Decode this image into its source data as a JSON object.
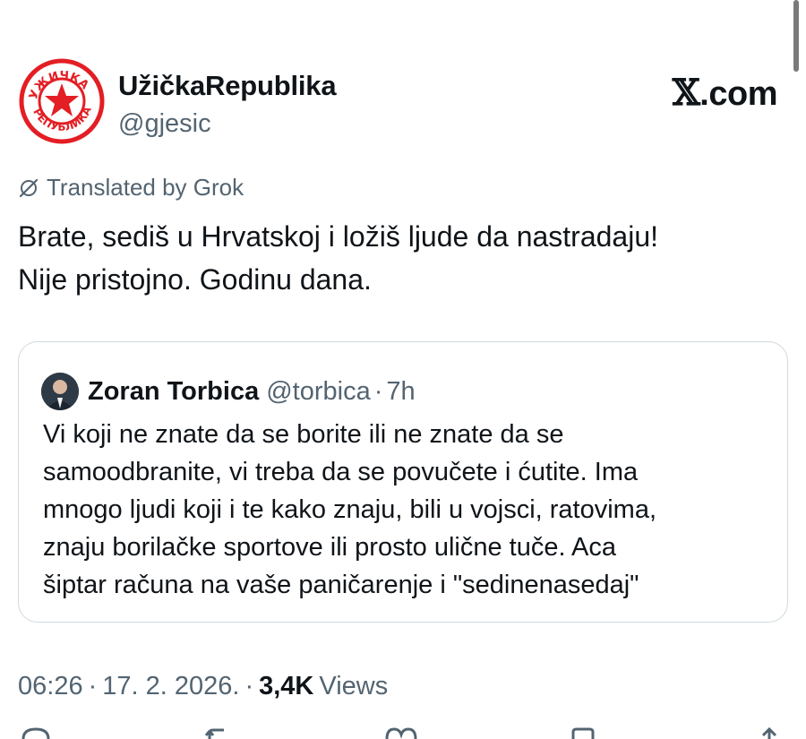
{
  "author": {
    "display_name": "UžičkaRepublika",
    "handle": "@gjesic",
    "avatar": {
      "icon": "red-star-emblem-icon",
      "text_top": "УЖИЧКА",
      "text_bottom": "РЕПУБЛИКА",
      "color": "#e31e24"
    }
  },
  "brand": {
    "x": "𝕏",
    "domain": ".com"
  },
  "translation": {
    "icon": "grok-icon",
    "label": "Translated by Grok"
  },
  "tweet": {
    "lines": [
      "Brate, sediš u Hrvatskoj i ložiš ljude da nastradaju!",
      "Nije pristojno. Godinu dana."
    ]
  },
  "quote": {
    "name": "Zoran Torbica",
    "handle": "@torbica",
    "separator": "·",
    "time": "7h",
    "lines": [
      "Vi koji ne znate da se borite ili ne znate da se",
      "samoodbranite, vi treba da se povučete i ćutite. Ima",
      "mnogo ljudi koji i te kako znaju, bili u vojsci, ratovima,",
      "znaju borilačke sportove ili prosto ulične tuče. Aca",
      "šiptar  računa na vaše paničarenje i \"sedinenasedaj\""
    ]
  },
  "meta": {
    "time": "06:26",
    "date": "17. 2. 2026.",
    "separator": "·",
    "views_count": "3,4K",
    "views_label": "Views"
  },
  "actions": [
    "reply-icon",
    "repost-icon",
    "like-icon",
    "bookmark-icon",
    "share-icon"
  ],
  "colors": {
    "text": "#0f1419",
    "secondary": "#536471",
    "border": "#cfd9de",
    "emblem_red": "#e31e24"
  }
}
